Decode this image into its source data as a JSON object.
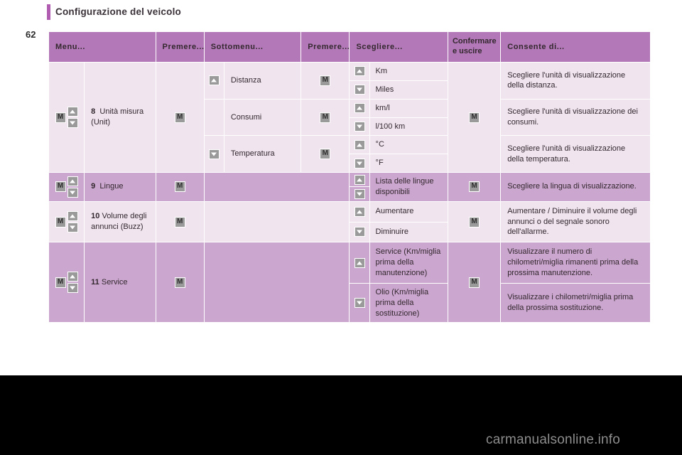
{
  "document": {
    "chapter_title": "Configurazione del veicolo",
    "page_number": "62",
    "watermark": "carmanualsonline.info",
    "accent_color": "#b05cb0",
    "header_row_color": "#b378b8",
    "row_tint_light": "#f0e4ef",
    "row_tint_dark": "#cba6cf",
    "button_color": "#9a9a9a"
  },
  "table": {
    "headers": [
      {
        "label": "Menu...",
        "style": "normal"
      },
      {
        "label": "Premere...",
        "style": "normal"
      },
      {
        "label": "Sottomenu...",
        "style": "normal"
      },
      {
        "label": "Premere...",
        "style": "normal"
      },
      {
        "label": "Scegliere...",
        "style": "normal"
      },
      {
        "label": "Confermare e uscire",
        "style": "small"
      },
      {
        "label": "Consente di...",
        "style": "normal"
      }
    ],
    "icons": {
      "m_button": "m-button-icon",
      "arrow_up": "arrow-up-icon",
      "arrow_down": "arrow-down-icon"
    },
    "rows": [
      {
        "index": "8",
        "menu": "Unità misura (Unit)",
        "tint": "light",
        "press": "M",
        "submenus": [
          {
            "nav": "up",
            "label": "Distanza",
            "press": "M",
            "options": [
              {
                "nav": "up",
                "label": "Km"
              },
              {
                "nav": "down",
                "label": "Miles"
              }
            ],
            "confirm": "M",
            "description": "Scegliere l'unità di visualizzazione della distanza."
          },
          {
            "nav": "none",
            "label": "Consumi",
            "press": "M",
            "options": [
              {
                "nav": "up",
                "label": "km/l"
              },
              {
                "nav": "down",
                "label": "l/100 km"
              }
            ],
            "confirm": "M",
            "description": "Scegliere l'unità di visualizzazione dei consumi."
          },
          {
            "nav": "down",
            "label": "Temperatura",
            "press": "M",
            "options": [
              {
                "nav": "up",
                "label": "°C"
              },
              {
                "nav": "down",
                "label": "°F"
              }
            ],
            "confirm": "M",
            "description": "Scegliere l'unità di visualizzazione della temperatura."
          }
        ]
      },
      {
        "index": "9",
        "menu": "Lingue",
        "tint": "dark",
        "press": "M",
        "submenus": [
          {
            "nav": "none",
            "label": "",
            "press": "",
            "options": [
              {
                "nav": "up",
                "label": "Lista delle lingue disponibili"
              },
              {
                "nav": "down",
                "label": ""
              }
            ],
            "confirm": "M",
            "description": "Scegliere la lingua di visualizzazione."
          }
        ]
      },
      {
        "index": "10",
        "menu": "Volume degli annunci (Buzz)",
        "tint": "light",
        "press": "M",
        "submenus": [
          {
            "nav": "none",
            "label": "",
            "press": "",
            "options": [
              {
                "nav": "up",
                "label": "Aumentare"
              },
              {
                "nav": "down",
                "label": "Diminuire"
              }
            ],
            "confirm": "M",
            "description": "Aumentare / Diminuire il volume degli annunci o del segnale sonoro dell'allarme."
          }
        ]
      },
      {
        "index": "11",
        "menu": "Service",
        "tint": "dark",
        "press": "M",
        "submenus": [
          {
            "nav": "none",
            "label": "",
            "press": "",
            "options": [
              {
                "nav": "up",
                "label": "Service (Km/miglia prima della manutenzione)"
              },
              {
                "nav": "down",
                "label": "Olio (Km/miglia prima della sostituzione)"
              }
            ],
            "confirm": "M",
            "description_1": "Visualizzare il numero di chilometri/miglia rimanenti prima della prossima manutenzione.",
            "description_2": "Visualizzare i chilometri/miglia prima della prossima sostituzione."
          }
        ]
      }
    ]
  }
}
